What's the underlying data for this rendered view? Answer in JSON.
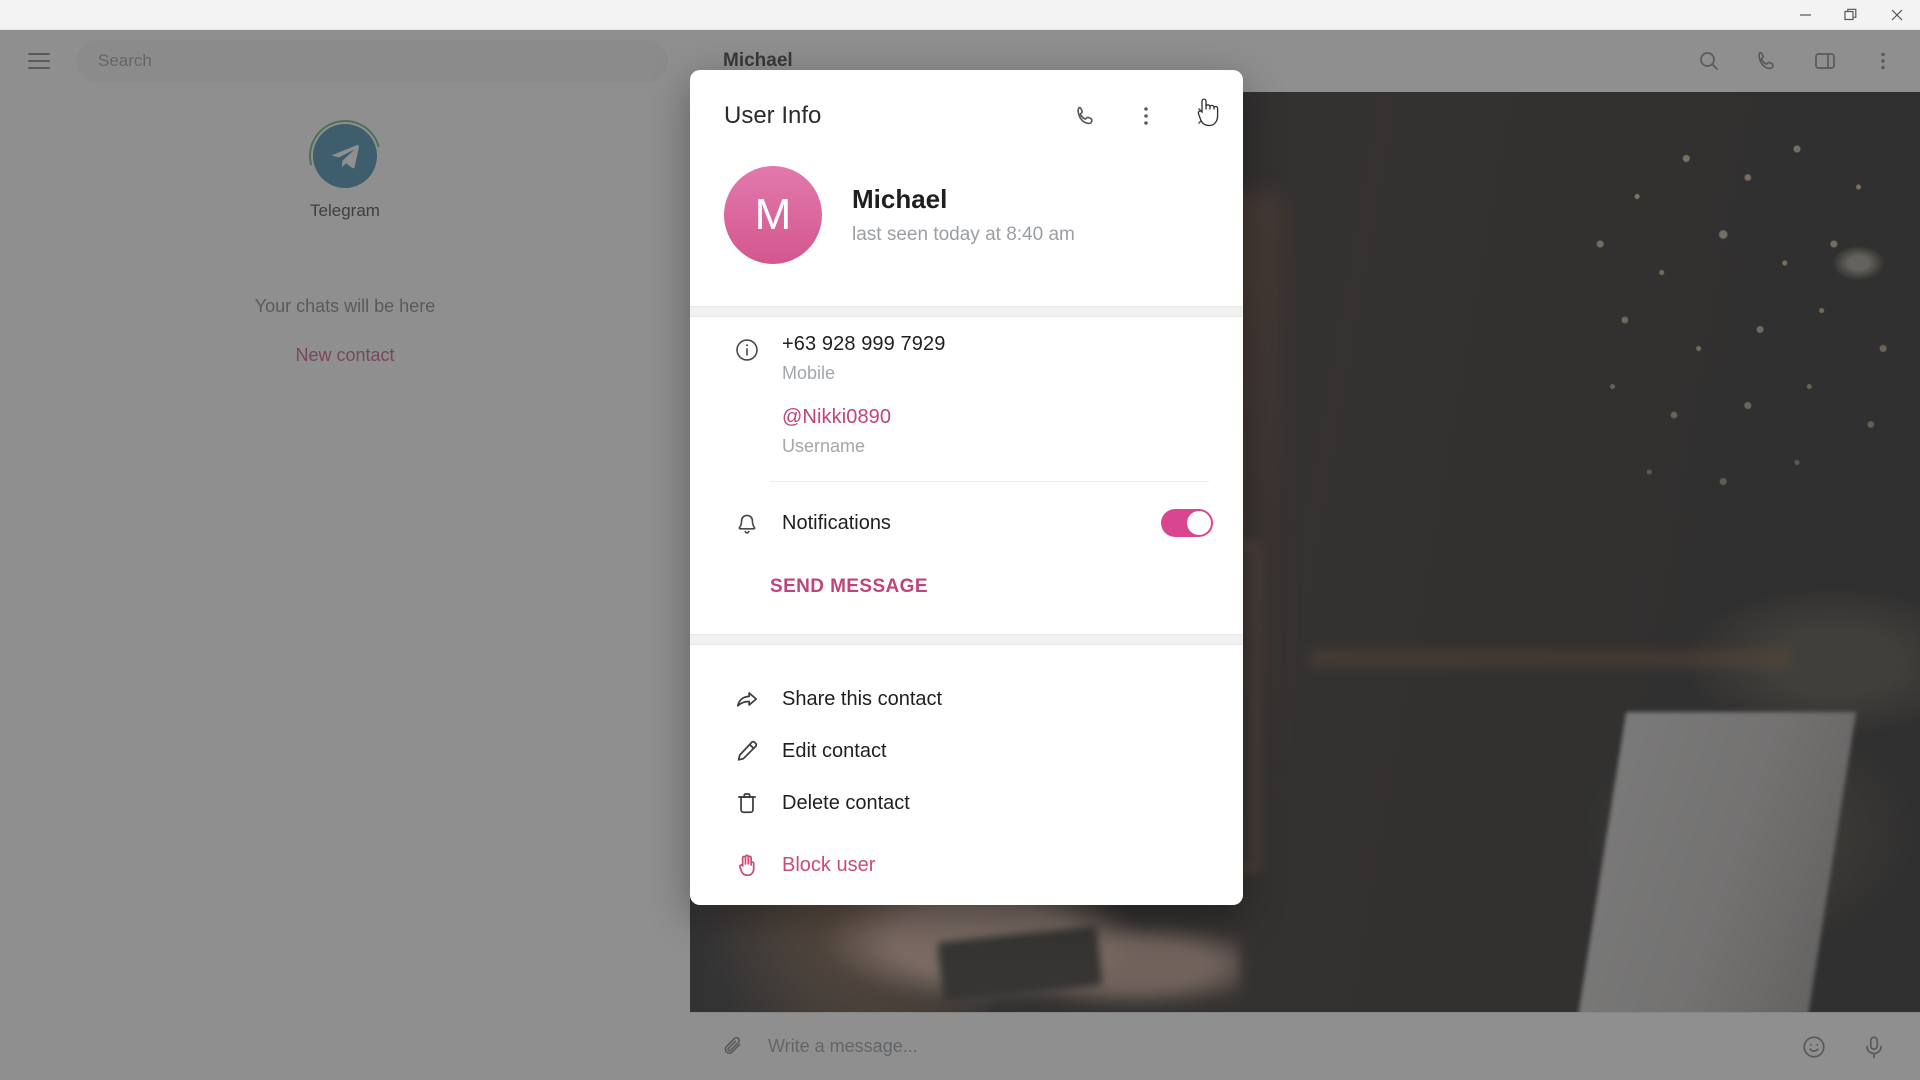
{
  "window": {
    "minimize_label": "Minimize",
    "maximize_label": "Restore",
    "close_label": "Close"
  },
  "sidebar": {
    "menu_icon": "hamburger-menu-icon",
    "search": {
      "placeholder": "Search",
      "value": ""
    },
    "app_name": "Telegram",
    "empty_hint": "Your chats will be here",
    "new_contact_label": "New contact"
  },
  "chat": {
    "title": "Michael",
    "header_icons": [
      "search-icon",
      "phone-icon",
      "sidebar-toggle-icon",
      "more-vertical-icon"
    ],
    "composer": {
      "attach_icon": "paperclip-icon",
      "placeholder": "Write a message...",
      "emoji_icon": "smiley-icon",
      "mic_icon": "microphone-icon"
    }
  },
  "dialog": {
    "title": "User Info",
    "header_icons": [
      "phone-icon",
      "more-vertical-icon",
      "close-icon"
    ],
    "avatar_initial": "M",
    "avatar_color": "#d9588f",
    "name": "Michael",
    "status": "last seen today at 8:40 am",
    "details": [
      {
        "icon": "info-circle-icon",
        "value": "+63 928 999 7929",
        "label": "Mobile",
        "is_link": false
      },
      {
        "icon": "",
        "value": "@Nikki0890",
        "label": "Username",
        "is_link": true
      }
    ],
    "notifications": {
      "icon": "bell-icon",
      "label": "Notifications",
      "enabled": true,
      "accent_color": "#d9468f"
    },
    "send_message_label": "SEND MESSAGE",
    "actions": [
      {
        "icon": "share-arrow-icon",
        "label": "Share this contact",
        "danger": false
      },
      {
        "icon": "pencil-icon",
        "label": "Edit contact",
        "danger": false
      },
      {
        "icon": "trash-icon",
        "label": "Delete contact",
        "danger": false
      },
      {
        "icon": "block-hand-icon",
        "label": "Block user",
        "danger": true
      }
    ],
    "link_color": "#c0447c",
    "danger_color": "#cb4b78"
  }
}
